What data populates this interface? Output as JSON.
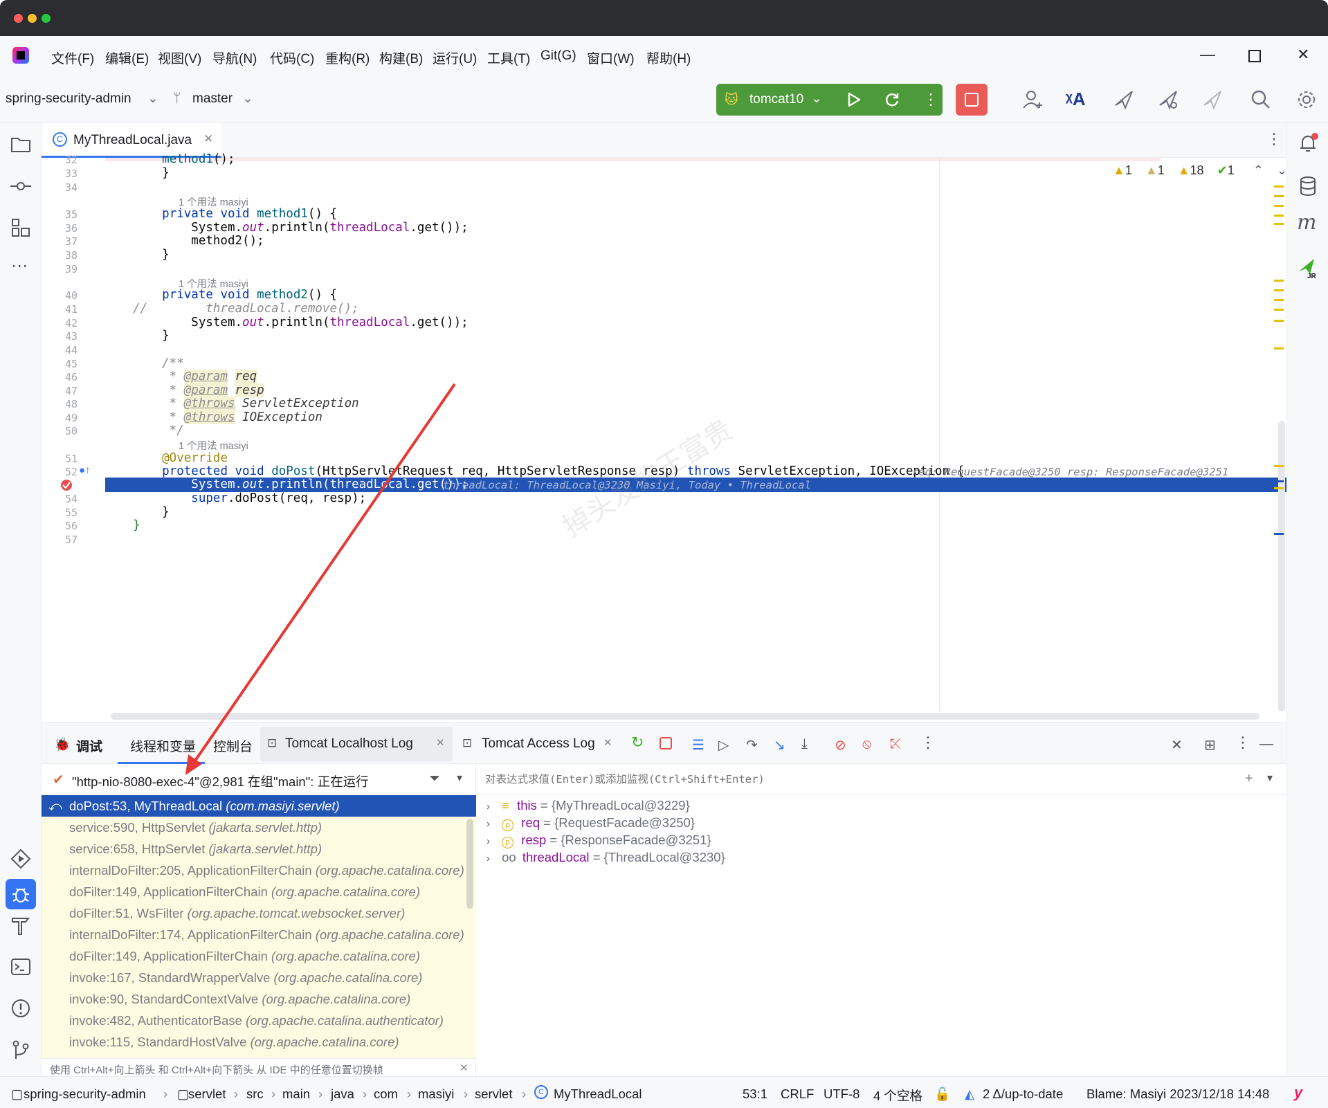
{
  "menu": [
    "文件(F)",
    "编辑(E)",
    "视图(V)",
    "导航(N)",
    "代码(C)",
    "重构(R)",
    "构建(B)",
    "运行(U)",
    "工具(T)",
    "Git(G)",
    "窗口(W)",
    "帮助(H)"
  ],
  "toolbar": {
    "project": "spring-security-admin",
    "branch": "master",
    "run_config": "tomcat10"
  },
  "editor": {
    "tab_label": "MyThreadLocal.java",
    "inspections": {
      "warn_a": "1",
      "warn_b": "1",
      "warn_c": "18",
      "ok": "1"
    },
    "lines": [
      {
        "n": "32",
        "code": "        method1();"
      },
      {
        "n": "33",
        "code": "    }"
      },
      {
        "n": "34",
        "code": ""
      },
      {
        "hint": "1 个用法   masiyi"
      },
      {
        "n": "35",
        "code": "    private void method1() {"
      },
      {
        "n": "36",
        "code": "        System.out.println(threadLocal.get());"
      },
      {
        "n": "37",
        "code": "        method2();"
      },
      {
        "n": "38",
        "code": "    }"
      },
      {
        "n": "39",
        "code": ""
      },
      {
        "hint": "1 个用法   masiyi"
      },
      {
        "n": "40",
        "code": "    private void method2() {"
      },
      {
        "n": "41",
        "code": "//        threadLocal.remove();"
      },
      {
        "n": "42",
        "code": "        System.out.println(threadLocal.get());"
      },
      {
        "n": "43",
        "code": "    }"
      },
      {
        "n": "44",
        "code": ""
      },
      {
        "n": "45",
        "code": "    /**"
      },
      {
        "n": "46",
        "code": "     * @param req"
      },
      {
        "n": "47",
        "code": "     * @param resp"
      },
      {
        "n": "48",
        "code": "     * @throws ServletException"
      },
      {
        "n": "49",
        "code": "     * @throws IOException"
      },
      {
        "n": "50",
        "code": "     */"
      },
      {
        "hint": "1 个用法   masiyi"
      },
      {
        "n": "51",
        "code": "    @Override"
      },
      {
        "n": "52",
        "code": "    protected void doPost(HttpServletRequest req, HttpServletResponse resp) throws ServletException, IOException {"
      },
      {
        "n": "53",
        "code": "        System.out.println(threadLocal.get());"
      },
      {
        "n": "54",
        "code": "        super.doPost(req, resp);"
      },
      {
        "n": "55",
        "code": "    }"
      },
      {
        "n": "56",
        "code": "}"
      },
      {
        "n": "57",
        "code": ""
      }
    ],
    "inlay_52": "req: RequestFacade@3250     resp: ResponseFacade@3251",
    "inlay_53": "threadLocal: ThreadLocal@3230",
    "blame_53": "Masiyi, Today • ThreadLocal",
    "watermark": "掉头发的王富贵"
  },
  "debug": {
    "tabs": [
      "调试",
      "线程和变量",
      "控制台",
      "Tomcat Localhost Log",
      "Tomcat Access Log"
    ],
    "thread": "\"http-nio-8080-exec-4\"@2,981 在组\"main\": 正在运行",
    "eval_placeholder": "对表达式求值(Enter)或添加监视(Ctrl+Shift+Enter)",
    "frames": [
      {
        "method": "doPost:53, MyThreadLocal",
        "pkg": "(com.masiyi.servlet)"
      },
      {
        "method": "service:590, HttpServlet",
        "pkg": "(jakarta.servlet.http)"
      },
      {
        "method": "service:658, HttpServlet",
        "pkg": "(jakarta.servlet.http)"
      },
      {
        "method": "internalDoFilter:205, ApplicationFilterChain",
        "pkg": "(org.apache.catalina.core)"
      },
      {
        "method": "doFilter:149, ApplicationFilterChain",
        "pkg": "(org.apache.catalina.core)"
      },
      {
        "method": "doFilter:51, WsFilter",
        "pkg": "(org.apache.tomcat.websocket.server)"
      },
      {
        "method": "internalDoFilter:174, ApplicationFilterChain",
        "pkg": "(org.apache.catalina.core)"
      },
      {
        "method": "doFilter:149, ApplicationFilterChain",
        "pkg": "(org.apache.catalina.core)"
      },
      {
        "method": "invoke:167, StandardWrapperValve",
        "pkg": "(org.apache.catalina.core)"
      },
      {
        "method": "invoke:90, StandardContextValve",
        "pkg": "(org.apache.catalina.core)"
      },
      {
        "method": "invoke:482, AuthenticatorBase",
        "pkg": "(org.apache.catalina.authenticator)"
      },
      {
        "method": "invoke:115, StandardHostValve",
        "pkg": "(org.apache.catalina.core)"
      }
    ],
    "hint_bar": "使用 Ctrl+Alt+向上箭头 和 Ctrl+Alt+向下箭头 从 IDE 中的任意位置切换帧",
    "variables": [
      {
        "name": "this",
        "value": "= {MyThreadLocal@3229}"
      },
      {
        "name": "req",
        "value": "= {RequestFacade@3250}"
      },
      {
        "name": "resp",
        "value": "= {ResponseFacade@3251}"
      },
      {
        "name": "threadLocal",
        "value": "= {ThreadLocal@3230}"
      }
    ]
  },
  "status": {
    "breadcrumb": [
      "spring-security-admin",
      "servlet",
      "src",
      "main",
      "java",
      "com",
      "masiyi",
      "servlet",
      "MyThreadLocal"
    ],
    "position": "53:1",
    "line_sep": "CRLF",
    "encoding": "UTF-8",
    "indent": "4 个空格",
    "vcs": "2 Δ/up-to-date",
    "blame": "Blame: Masiyi 2023/12/18 14:48"
  },
  "colors": {
    "accent": "#2154b5",
    "run_green": "#4d9a3b",
    "stop_red": "#e85b57",
    "arrow_red": "#e53935"
  }
}
